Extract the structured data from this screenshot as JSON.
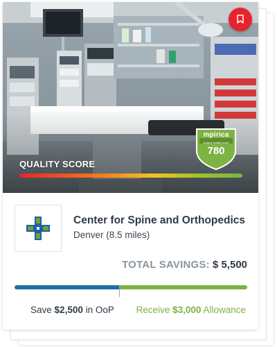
{
  "card": {
    "bookmark_icon": "bookmark-icon",
    "quality": {
      "label": "QUALITY SCORE",
      "badge_brand": "mpirica",
      "badge_subtitle": "surgery quality score",
      "score": "780"
    },
    "provider": {
      "logo_icon": "medical-cross-logo",
      "name": "Center for Spine and Orthopedics",
      "location": "Denver (8.5 miles)"
    },
    "savings": {
      "total_label": "TOTAL SAVINGS:",
      "total_amount": "$ 5,500",
      "oop_share": 0.45,
      "save_prefix": "Save",
      "save_amount": "$2,500",
      "save_suffix": "in OoP",
      "receive_prefix": "Receive",
      "receive_amount": "$3,000",
      "receive_suffix": "Allowance"
    },
    "colors": {
      "bookmark": "#e8232e",
      "oop_bar": "#1f6fa3",
      "allowance_bar": "#7cb342",
      "logo_blue": "#1f5fa6",
      "logo_green": "#6aa33a"
    }
  }
}
